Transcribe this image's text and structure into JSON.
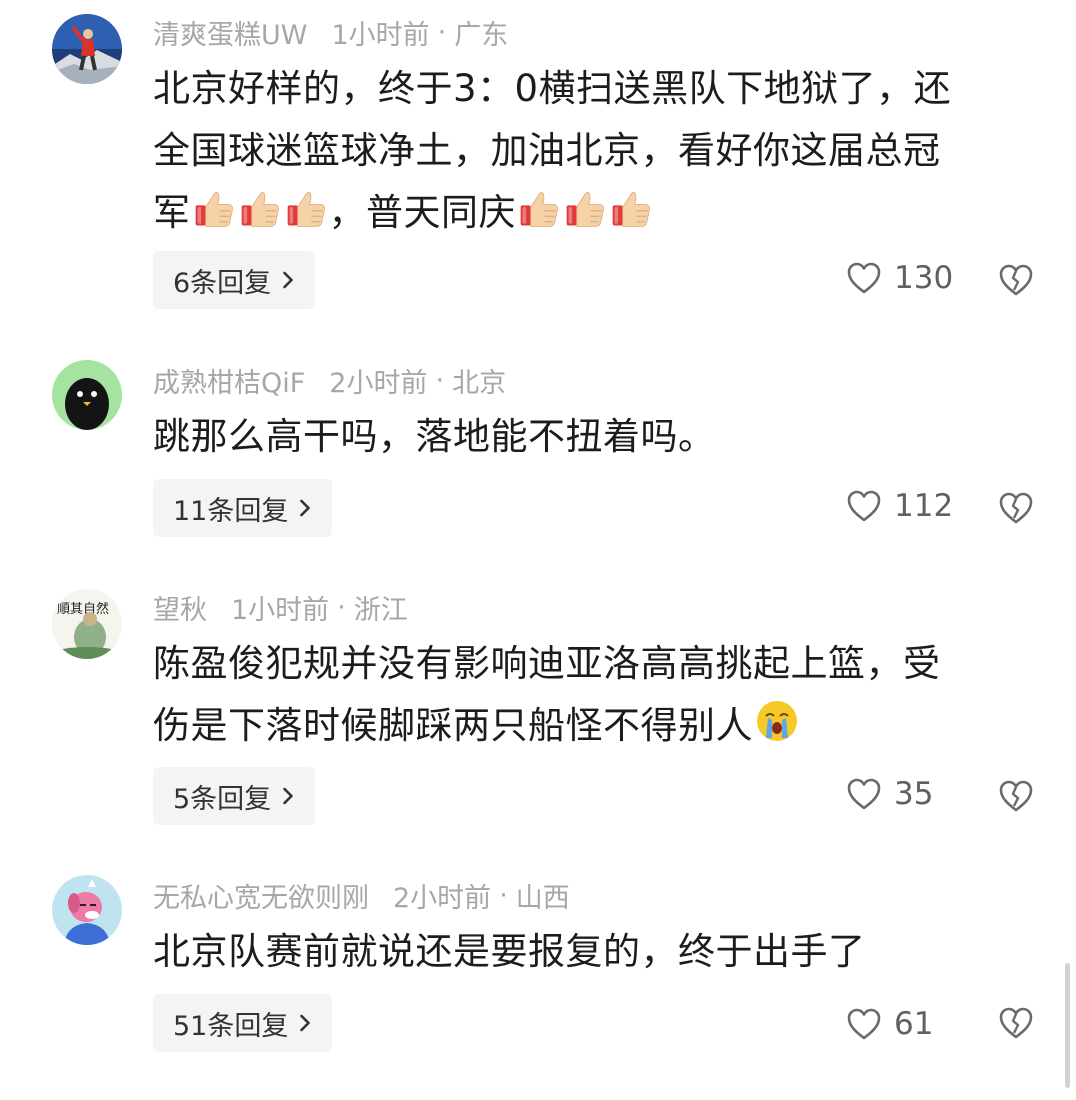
{
  "comments": [
    {
      "username": "清爽蛋糕UW",
      "time": "1小时前",
      "dot": "·",
      "location": "广东",
      "text_line1": "北京好样的，终于3：0横扫送黑队下地狱了，还",
      "text_line2": "全国球迷篮球净土，加油北京，看好你这届总冠",
      "text_line3a": "军",
      "text_line3b": "，普天同庆",
      "replies": "6条回复",
      "likes": "130"
    },
    {
      "username": "成熟柑桔QiF",
      "time": "2小时前",
      "dot": "·",
      "location": "北京",
      "text_line1": "跳那么高干吗，落地能不扭着吗。",
      "replies": "11条回复",
      "likes": "112"
    },
    {
      "username": "望秋",
      "time": "1小时前",
      "dot": "·",
      "location": "浙江",
      "text_line1": "陈盈俊犯规并没有影响迪亚洛高高挑起上篮，受",
      "text_line2": "伤是下落时候脚踩两只船怪不得别人",
      "avatar_text": "順其自然",
      "replies": "5条回复",
      "likes": "35"
    },
    {
      "username": "无私心宽无欲则刚",
      "time": "2小时前",
      "dot": "·",
      "location": "山西",
      "text_line1": "北京队赛前就说还是要报复的，终于出手了",
      "replies": "51条回复",
      "likes": "61"
    }
  ],
  "icons": {
    "like": "heart-outline-icon",
    "dislike": "broken-heart-icon",
    "chevron": "chevron-right-icon",
    "thumbs": "thumbs-up-emoji",
    "crying": "crying-face-emoji"
  },
  "colors": {
    "meta": "#a7a7a7",
    "text": "#1c1c1c",
    "reply_bg": "#f4f4f4"
  }
}
